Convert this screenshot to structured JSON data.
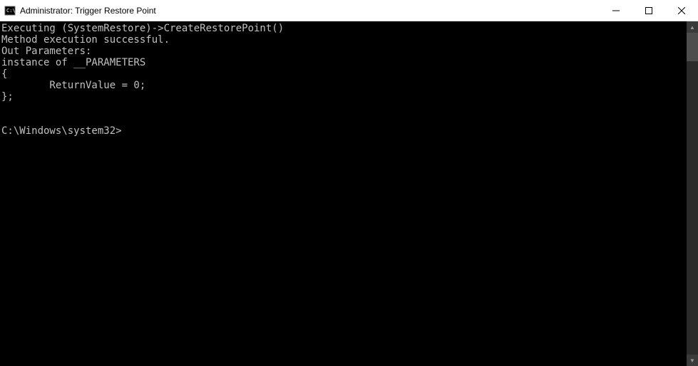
{
  "window": {
    "title": "Administrator: Trigger Restore Point"
  },
  "console": {
    "lines": [
      "Executing (SystemRestore)->CreateRestorePoint()",
      "Method execution successful.",
      "Out Parameters:",
      "instance of __PARAMETERS",
      "{",
      "        ReturnValue = 0;",
      "};",
      "",
      "",
      "C:\\Windows\\system32>"
    ]
  }
}
